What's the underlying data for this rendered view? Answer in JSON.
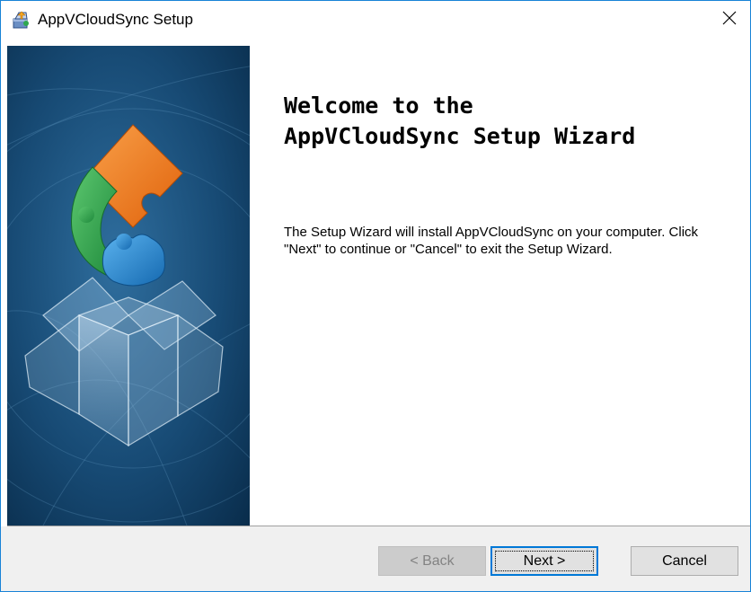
{
  "window": {
    "title": "AppVCloudSync Setup",
    "app_icon": "installer-package-icon",
    "close_icon": "close-icon"
  },
  "banner": {
    "image": "puzzle-box-banner",
    "colors": {
      "background": "#0a3358",
      "orange": "#f07c1c",
      "green": "#2fa84f",
      "blue": "#1f8ad6"
    }
  },
  "content": {
    "heading_line1": "Welcome to the",
    "heading_line2": "AppVCloudSync Setup Wizard",
    "description": "The Setup Wizard will install AppVCloudSync on your computer.  Click \"Next\" to continue or \"Cancel\" to exit the Setup Wizard."
  },
  "buttons": {
    "back": {
      "label": "< Back",
      "enabled": false
    },
    "next": {
      "label": "Next >",
      "enabled": true,
      "focused": true
    },
    "cancel": {
      "label": "Cancel",
      "enabled": true
    }
  },
  "colors": {
    "accent": "#0078d7",
    "footer": "#f0f0f0",
    "window_border": "#1883d7"
  }
}
